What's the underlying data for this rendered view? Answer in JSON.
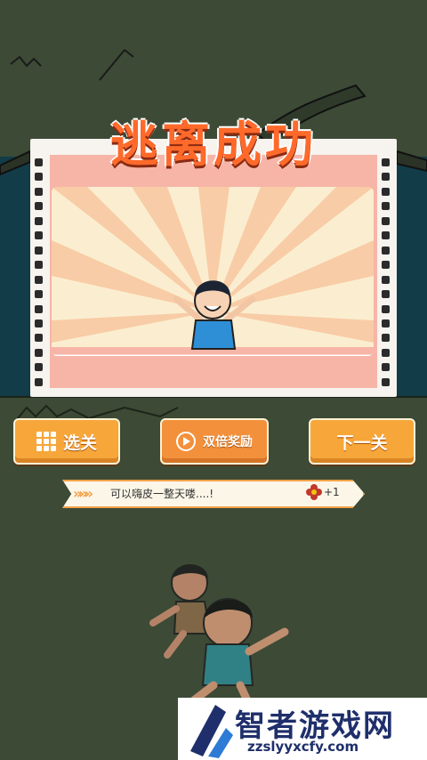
{
  "result": {
    "title": "逃离成功"
  },
  "buttons": {
    "select_level": "选关",
    "double_reward": "双倍奖励",
    "next_level": "下一关"
  },
  "banner": {
    "text": "可以嗨皮一整天喽....!",
    "reward": "+1"
  },
  "watermark": {
    "name": "智者游戏网",
    "url": "zzslyyxcfy.com"
  },
  "icons": [
    "grid-icon",
    "play-icon",
    "flower-icon",
    "chevron-icon"
  ],
  "colors": {
    "background": "#3c4a36",
    "orange": "#f7a63a",
    "title": "#ff6a2a",
    "film": "#f6b5a7"
  }
}
